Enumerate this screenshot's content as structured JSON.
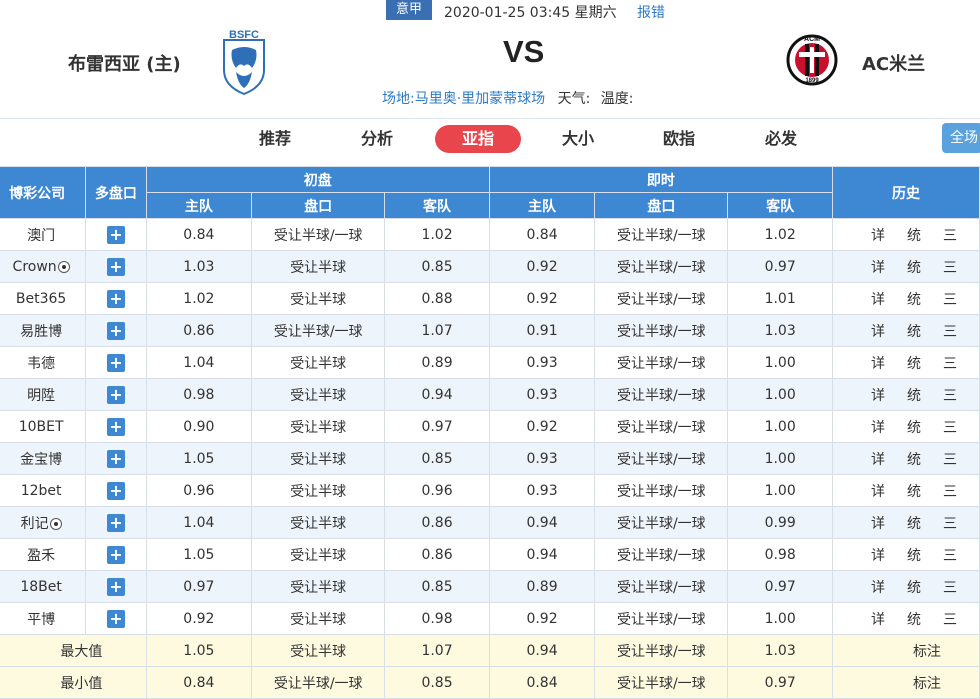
{
  "header": {
    "league": "意甲",
    "time": "2020-01-25 03:45 星期六",
    "report": "报错",
    "home": "布雷西亚 (主)",
    "away": "AC米兰",
    "vs": "VS",
    "venue_label": "场地:",
    "venue": "马里奥·里加蒙蒂球场",
    "weather_label": "天气:",
    "temp_label": "温度:",
    "home_logo_text": "BSFC",
    "away_logo_text": "ACM",
    "away_logo_year": "1899"
  },
  "tabs": [
    "推荐",
    "分析",
    "亚指",
    "大小",
    "欧指",
    "必发"
  ],
  "active_tab": "亚指",
  "full_button": "全场",
  "table": {
    "col_company": "博彩公司",
    "col_multi": "多盘口",
    "group_initial": "初盘",
    "group_live": "即时",
    "group_history": "历史",
    "sub_home": "主队",
    "sub_line": "盘口",
    "sub_away": "客队",
    "rows": [
      {
        "company": "澳门",
        "ball": false,
        "i_home": "0.84",
        "i_line": "受让半球/一球",
        "i_away": "1.02",
        "l_home": "0.84",
        "l_line": "受让半球/一球",
        "l_away": "1.02"
      },
      {
        "company": "Crown",
        "ball": true,
        "i_home": "1.03",
        "i_line": "受让半球",
        "i_away": "0.85",
        "l_home": "0.92",
        "l_line": "受让半球/一球",
        "l_away": "0.97"
      },
      {
        "company": "Bet365",
        "ball": false,
        "i_home": "1.02",
        "i_line": "受让半球",
        "i_away": "0.88",
        "l_home": "0.92",
        "l_line": "受让半球/一球",
        "l_away": "1.01"
      },
      {
        "company": "易胜博",
        "ball": false,
        "i_home": "0.86",
        "i_line": "受让半球/一球",
        "i_away": "1.07",
        "l_home": "0.91",
        "l_line": "受让半球/一球",
        "l_away": "1.03"
      },
      {
        "company": "韦德",
        "ball": false,
        "i_home": "1.04",
        "i_line": "受让半球",
        "i_away": "0.89",
        "l_home": "0.93",
        "l_line": "受让半球/一球",
        "l_away": "1.00"
      },
      {
        "company": "明陞",
        "ball": false,
        "i_home": "0.98",
        "i_line": "受让半球",
        "i_away": "0.94",
        "l_home": "0.93",
        "l_line": "受让半球/一球",
        "l_away": "1.00"
      },
      {
        "company": "10BET",
        "ball": false,
        "i_home": "0.90",
        "i_line": "受让半球",
        "i_away": "0.97",
        "l_home": "0.92",
        "l_line": "受让半球/一球",
        "l_away": "1.00"
      },
      {
        "company": "金宝博",
        "ball": false,
        "i_home": "1.05",
        "i_line": "受让半球",
        "i_away": "0.85",
        "l_home": "0.93",
        "l_line": "受让半球/一球",
        "l_away": "1.00"
      },
      {
        "company": "12bet",
        "ball": false,
        "i_home": "0.96",
        "i_line": "受让半球",
        "i_away": "0.96",
        "l_home": "0.93",
        "l_line": "受让半球/一球",
        "l_away": "1.00"
      },
      {
        "company": "利记",
        "ball": true,
        "i_home": "1.04",
        "i_line": "受让半球",
        "i_away": "0.86",
        "l_home": "0.94",
        "l_line": "受让半球/一球",
        "l_away": "0.99"
      },
      {
        "company": "盈禾",
        "ball": false,
        "i_home": "1.05",
        "i_line": "受让半球",
        "i_away": "0.86",
        "l_home": "0.94",
        "l_line": "受让半球/一球",
        "l_away": "0.98"
      },
      {
        "company": "18Bet",
        "ball": false,
        "i_home": "0.97",
        "i_line": "受让半球",
        "i_away": "0.85",
        "l_home": "0.89",
        "l_line": "受让半球/一球",
        "l_away": "0.97"
      },
      {
        "company": "平博",
        "ball": false,
        "i_home": "0.92",
        "i_line": "受让半球",
        "i_away": "0.98",
        "l_home": "0.92",
        "l_line": "受让半球/一球",
        "l_away": "1.00"
      }
    ],
    "history_links": [
      "详",
      "统",
      "三"
    ],
    "summary": [
      {
        "label": "最大值",
        "i_home": "1.05",
        "i_line": "受让半球",
        "i_away": "1.07",
        "l_home": "0.94",
        "l_line": "受让半球/一球",
        "l_away": "1.03",
        "note": "标注"
      },
      {
        "label": "最小值",
        "i_home": "0.84",
        "i_line": "受让半球/一球",
        "i_away": "0.85",
        "l_home": "0.84",
        "l_line": "受让半球/一球",
        "l_away": "0.97",
        "note": "标注"
      }
    ]
  },
  "colors": {
    "header_blue": "#3e87d3",
    "active_tab": "#e8464c",
    "link": "#2e7bc4",
    "summary_bg": "#fdfadf"
  }
}
